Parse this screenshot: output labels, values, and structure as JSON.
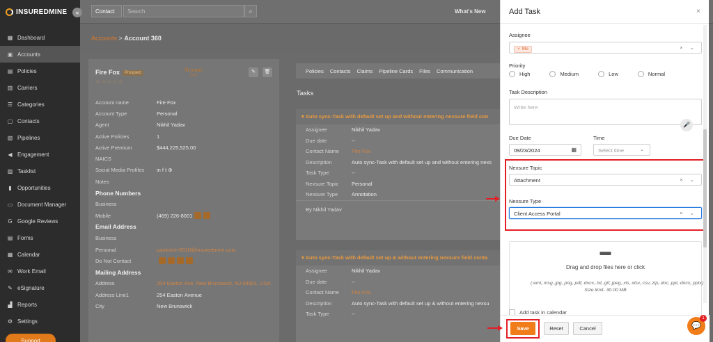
{
  "sidebar": {
    "brand": "INSUREDMINE",
    "collapse_glyph": "«",
    "items": [
      {
        "label": "Dashboard",
        "icon": "grid-icon",
        "glyph": "▦"
      },
      {
        "label": "Accounts",
        "icon": "accounts-icon",
        "glyph": "▣"
      },
      {
        "label": "Policies",
        "icon": "policies-icon",
        "glyph": "▤"
      },
      {
        "label": "Carriers",
        "icon": "carriers-icon",
        "glyph": "▥"
      },
      {
        "label": "Categories",
        "icon": "categories-icon",
        "glyph": "☰"
      },
      {
        "label": "Contacts",
        "icon": "contacts-icon",
        "glyph": "▢"
      },
      {
        "label": "Pipelines",
        "icon": "pipelines-icon",
        "glyph": "▧"
      },
      {
        "label": "Engagement",
        "icon": "megaphone-icon",
        "glyph": "◀"
      },
      {
        "label": "Tasklist",
        "icon": "tasklist-icon",
        "glyph": "▨"
      },
      {
        "label": "Opportunities",
        "icon": "chart-icon",
        "glyph": "▮"
      },
      {
        "label": "Document Manager",
        "icon": "folder-icon",
        "glyph": "▭"
      },
      {
        "label": "Google Reviews",
        "icon": "google-icon",
        "glyph": "G"
      },
      {
        "label": "Forms",
        "icon": "forms-icon",
        "glyph": "▤"
      },
      {
        "label": "Calendar",
        "icon": "calendar-icon",
        "glyph": "▦"
      },
      {
        "label": "Work Email",
        "icon": "email-icon",
        "glyph": "✉"
      },
      {
        "label": "eSignature",
        "icon": "signature-icon",
        "glyph": "✎"
      },
      {
        "label": "Reports",
        "icon": "reports-icon",
        "glyph": "▟"
      },
      {
        "label": "Settings",
        "icon": "gear-icon",
        "glyph": "⚙"
      }
    ],
    "support": "Support"
  },
  "topbar": {
    "select_value": "Contact",
    "search_placeholder": "Search",
    "search_glyph": "⌕",
    "whats_new": "What's New"
  },
  "breadcrumb": {
    "parent": "Accounts",
    "separator": ">",
    "current": "Account 360"
  },
  "account": {
    "name": "Fire Fox",
    "status": "Prospect",
    "stars": "☆☆☆☆☆",
    "partner_logo": "Nexsure",
    "partner_logo_sub": "Sync",
    "edit_glyph": "✎",
    "delete_glyph": "🗑",
    "rows": [
      {
        "k": "Account name",
        "v": "Fire Fox"
      },
      {
        "k": "Account Type",
        "v": "Personal"
      },
      {
        "k": "Agent",
        "v": "Nikhil Yadav"
      },
      {
        "k": "Active Policies",
        "v": "1"
      },
      {
        "k": "Active Premium",
        "v": "$444,225,525.00"
      },
      {
        "k": "NAICS",
        "v": ""
      },
      {
        "k": "Social Media Profiles",
        "v": "in f t ⊕"
      },
      {
        "k": "Notes",
        "v": ""
      },
      {
        "h": "Phone Numbers"
      },
      {
        "k": "Business",
        "v": ""
      },
      {
        "k": "Mobile",
        "v": "(469) 226-8001"
      },
      {
        "h": "Email Address"
      },
      {
        "k": "Business",
        "v": ""
      },
      {
        "k": "Personal",
        "v": "parikshit+0010@insuredmine.com",
        "o": true
      },
      {
        "k": "Do Not Contact",
        "v": ""
      },
      {
        "h": "Mailing Address"
      },
      {
        "k": "Address",
        "v": "204 Easton Ave, New Brunswick, NJ 08901, USA",
        "o": true
      },
      {
        "k": "Address Line1",
        "v": "254 Easton Avenue"
      },
      {
        "k": "City",
        "v": "New Brunswick"
      }
    ]
  },
  "tabs": [
    "Policies",
    "Contacts",
    "Claims",
    "Pipeline Cards",
    "Files",
    "Communication"
  ],
  "tasks": {
    "heading": "Tasks",
    "cards": [
      {
        "title": "Auto sync-Task with default set up and without entering nexsure field con",
        "rows": [
          {
            "k": "Assignee",
            "v": "Nikhil Yadav"
          },
          {
            "k": "Due date",
            "v": "--"
          },
          {
            "k": "Contact Name",
            "v": "Fire Fox",
            "o": true
          },
          {
            "k": "Description",
            "v": "Auto sync-Task with default set up and without entering nexs"
          },
          {
            "k": "Task Type",
            "v": "--"
          },
          {
            "k": "Nexsure Topic",
            "v": "Personal"
          },
          {
            "k": "Nexsure Type",
            "v": "Annotation"
          }
        ],
        "by": "By Nikhil Yadav"
      },
      {
        "title": "Auto sync-Task with default set up & without entering nexsure field conta",
        "rows": [
          {
            "k": "Assignee",
            "v": "Nikhil Yadav"
          },
          {
            "k": "Due date",
            "v": "--"
          },
          {
            "k": "Contact Name",
            "v": "Fire Fox",
            "o": true
          },
          {
            "k": "Description",
            "v": "Auto sync-Task with default set up & without entering nexsu"
          },
          {
            "k": "Task Type",
            "v": "--"
          }
        ]
      }
    ]
  },
  "modal": {
    "title": "Add Task",
    "close_glyph": "×",
    "assignee_label": "Assignee",
    "assignee_chip": "Me",
    "priority_label": "Priority",
    "priorities": [
      "High",
      "Medium",
      "Low",
      "Normal"
    ],
    "description_label": "Task Description",
    "description_placeholder": "Write here",
    "due_label": "Due Date",
    "due_value": "09/23/2024",
    "time_label": "Time",
    "time_placeholder": "Select time",
    "topic_label": "Nexsure Topic",
    "topic_value": "Attachment",
    "type_label": "Nexsure Type",
    "type_value": "Client Access Portal",
    "drop_text": "Drag and drop files here or click",
    "drop_hint": "(.eml,.msg,.jpg,.png,.pdf,.docx,.txt,.gif,.jpeg,.xls,.xlsx,.csv,.zip,.doc,.ppt,.docx,.pptx) Size limit- 30.00 MB",
    "calendar_label": "Add task in calendar",
    "save": "Save",
    "reset": "Reset",
    "cancel": "Cancel"
  },
  "chat": {
    "badge": "1"
  },
  "colors": {
    "accent": "#f07c1a",
    "highlight": "#e31e24",
    "focus": "#2a7de1"
  }
}
